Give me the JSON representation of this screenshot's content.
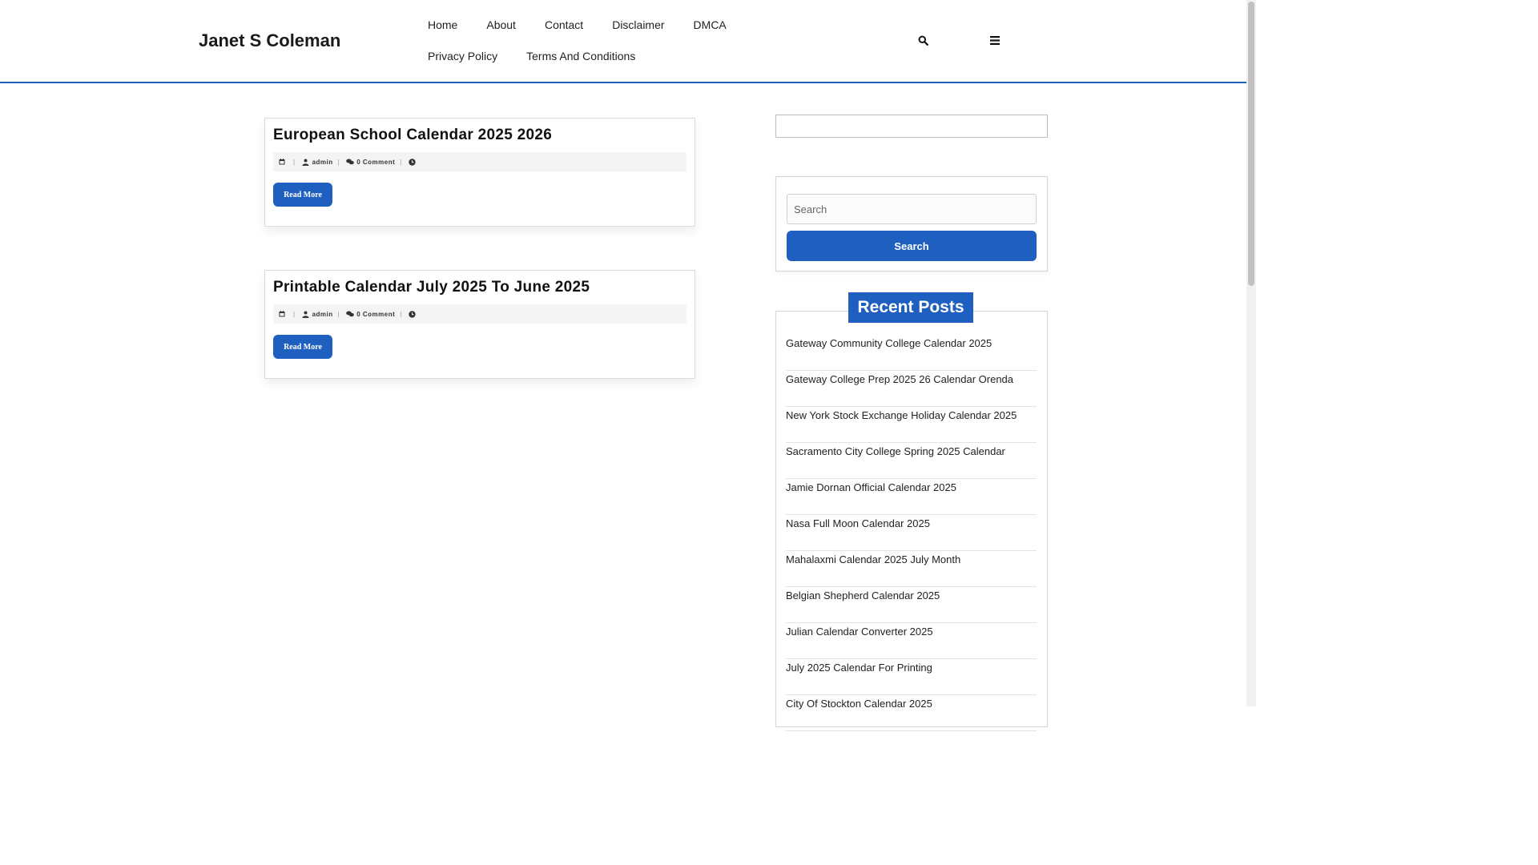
{
  "site": {
    "title": "Janet S Coleman"
  },
  "nav": {
    "items": [
      "Home",
      "About",
      "Contact",
      "Disclaimer",
      "DMCA",
      "Privacy Policy",
      "Terms And Conditions"
    ]
  },
  "header_icons": [
    "search-icon",
    "menu-bars-icon"
  ],
  "posts": [
    {
      "title": "European School Calendar 2025 2026",
      "author": "admin",
      "comments": "0 Comment",
      "read_more": "Read More"
    },
    {
      "title": "Printable Calendar July 2025 To June 2025",
      "author": "admin",
      "comments": "0 Comment",
      "read_more": "Read More"
    }
  ],
  "meta_icons": [
    "calendar-icon",
    "user-icon",
    "comments-icon",
    "clock-icon"
  ],
  "search_widget": {
    "placeholder": "Search",
    "button_label": "Search"
  },
  "recent_posts": {
    "heading": "Recent Posts",
    "items": [
      "Gateway Community College Calendar 2025",
      "Gateway College Prep 2025 26 Calendar Orenda",
      "New York Stock Exchange Holiday Calendar 2025",
      "Sacramento City College Spring 2025 Calendar",
      "Jamie Dornan Official Calendar 2025",
      "Nasa Full Moon Calendar 2025",
      "Mahalaxmi Calendar 2025 July Month",
      "Belgian Shepherd Calendar 2025",
      "Julian Calendar Converter 2025",
      "July 2025 Calendar For Printing",
      "City Of Stockton Calendar 2025"
    ]
  },
  "colors": {
    "accent": "#1f5fbf",
    "meta_bg": "#f4f4f4",
    "border": "#dcdcdc"
  }
}
